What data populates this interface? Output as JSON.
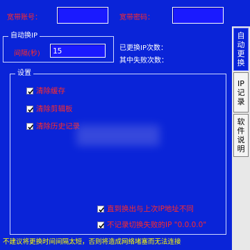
{
  "header": {
    "account_label": "宽带账号：",
    "account_value": "",
    "password_label": "宽带密码：",
    "password_value": ""
  },
  "auto_ip": {
    "group_title": "自动换IP",
    "interval_label": "间隔(秒)",
    "interval_value": "15",
    "changed_count_label": "已更换IP次数：",
    "failed_count_label": "其中失败次数："
  },
  "settings": {
    "group_title": "设置",
    "checks": [
      {
        "label": "清除缓存",
        "checked": true
      },
      {
        "label": "清除剪辑板",
        "checked": true
      },
      {
        "label": "清除历史记录",
        "checked": true
      }
    ],
    "bottom_checks": [
      {
        "label": "直到换出与上次IP地址不同",
        "checked": true
      },
      {
        "label": "不记录切换失败的IP \"0.0.0.0\"",
        "checked": true
      }
    ]
  },
  "footer": {
    "warning": "不建议将更换时间间隔太短，否则将造成网络堵塞而无法连接"
  },
  "side_tabs": [
    {
      "label": "自动更换",
      "active": true
    },
    {
      "label": "IP记录",
      "active": false
    },
    {
      "label": "软件说明",
      "active": false
    }
  ]
}
